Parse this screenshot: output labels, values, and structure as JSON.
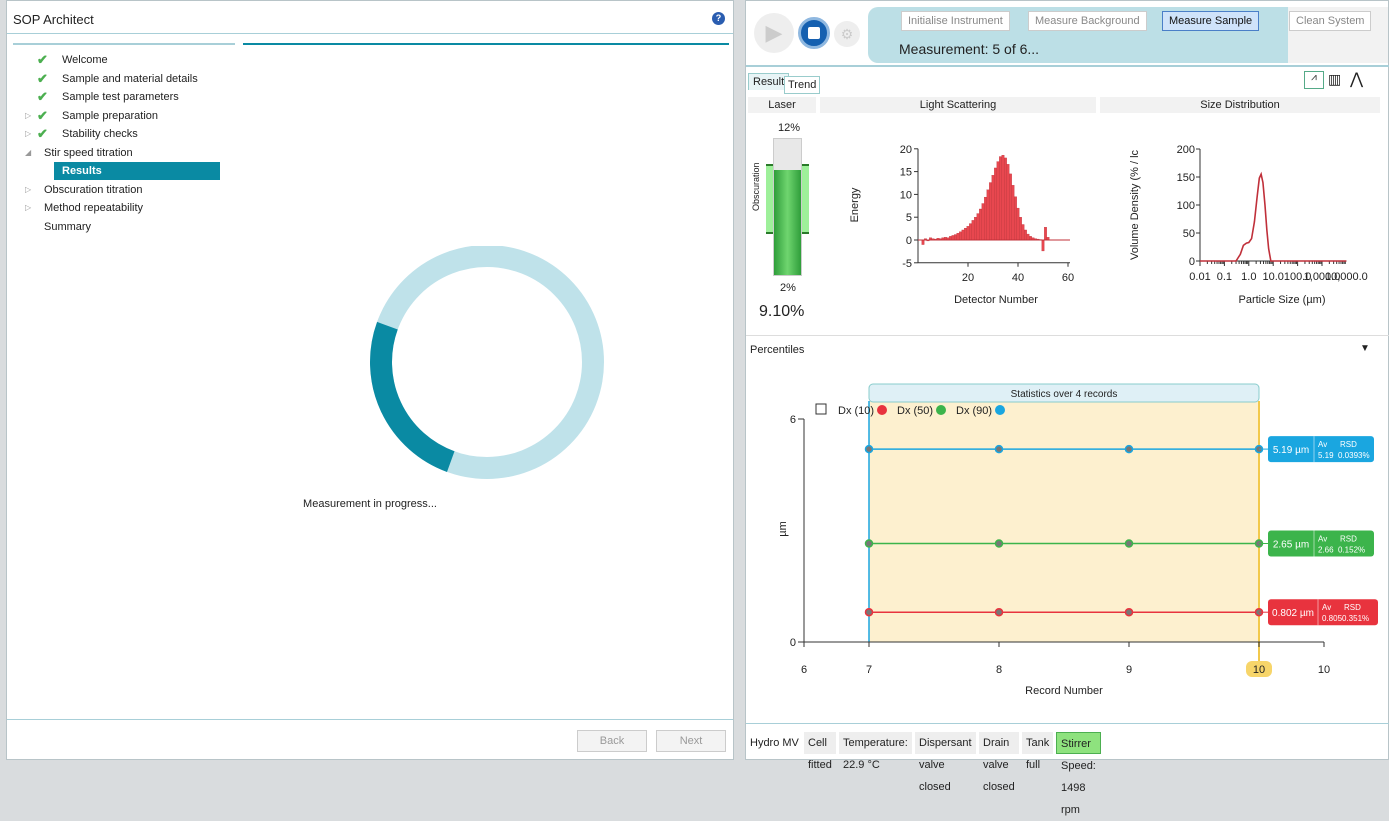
{
  "left": {
    "title": "SOP Architect",
    "help_icon": "help-icon",
    "tree": [
      {
        "label": "Welcome",
        "checked": true,
        "expandable": false,
        "indent": 0
      },
      {
        "label": "Sample and material details",
        "checked": true,
        "expandable": false,
        "indent": 0
      },
      {
        "label": "Sample test parameters",
        "checked": true,
        "expandable": false,
        "indent": 0
      },
      {
        "label": "Sample preparation",
        "checked": true,
        "expandable": true,
        "indent": 0
      },
      {
        "label": "Stability checks",
        "checked": true,
        "expandable": true,
        "indent": 0
      },
      {
        "label": "Stir speed titration",
        "checked": false,
        "expanded": true,
        "indent": 0
      },
      {
        "label": "Results",
        "checked": false,
        "selected": true,
        "indent": 1
      },
      {
        "label": "Obscuration titration",
        "checked": false,
        "expandable": true,
        "indent": 0
      },
      {
        "label": "Method repeatability",
        "checked": false,
        "expandable": true,
        "indent": 0
      },
      {
        "label": "Summary",
        "checked": false,
        "expandable": false,
        "indent": 0
      }
    ],
    "progress_text": "Measurement in progress...",
    "progress_fraction": 0.25,
    "back": "Back",
    "next": "Next"
  },
  "right": {
    "workflow": [
      "Initialise Instrument",
      "Measure Background",
      "Measure Sample",
      "Clean System"
    ],
    "active_step": "Measure Sample",
    "measurement": "Measurement: 5 of 6...",
    "tabs": [
      "Result",
      "Trend"
    ],
    "panels": {
      "laser": "Laser",
      "scatter": "Light Scattering",
      "size": "Size Distribution"
    },
    "laser": {
      "top_label": "12%",
      "bottom_label": "2%",
      "axis": "Obscuration",
      "value": "9.10%",
      "obscuration_pct": 9.1
    },
    "percentiles": "Percentiles",
    "status": {
      "device": "Hydro MV",
      "items": [
        "Cell fitted",
        "Temperature: 22.9 °C",
        "Dispersant valve closed",
        "Drain valve closed",
        "Tank full"
      ],
      "stirrer": "Stirrer Speed: 1498 rpm"
    }
  },
  "colors": {
    "accent": "#0a8aa3",
    "red": "#e8333e",
    "green": "#3cb44b",
    "blue": "#1aa6e0",
    "stats_fill": "#fdf0cf"
  },
  "chart_data": [
    {
      "type": "bar",
      "title": "Light Scattering",
      "xlabel": "Detector Number",
      "ylabel": "Energy",
      "xlim": [
        0,
        62
      ],
      "ylim": [
        -5,
        20
      ],
      "xticks": [
        20,
        40,
        60
      ],
      "yticks": [
        -5,
        0,
        5,
        10,
        15,
        20
      ],
      "x": [
        2,
        3,
        4,
        5,
        6,
        7,
        8,
        9,
        10,
        11,
        12,
        13,
        14,
        15,
        16,
        17,
        18,
        19,
        20,
        21,
        22,
        23,
        24,
        25,
        26,
        27,
        28,
        29,
        30,
        31,
        32,
        33,
        34,
        35,
        36,
        37,
        38,
        39,
        40,
        41,
        42,
        43,
        44,
        45,
        46,
        47,
        48,
        49,
        50,
        51,
        52
      ],
      "values": [
        -1,
        0.3,
        -0.2,
        0.5,
        0.3,
        0.2,
        0.4,
        0.3,
        0.5,
        0.6,
        0.5,
        0.8,
        1,
        1.2,
        1.5,
        1.8,
        2.2,
        2.6,
        3,
        3.6,
        4.3,
        5,
        5.8,
        6.8,
        8,
        9.4,
        11,
        12.6,
        14.2,
        15.8,
        17.2,
        18.3,
        18.6,
        18,
        16.6,
        14.5,
        12,
        9.5,
        7,
        5,
        3.4,
        2.2,
        1.3,
        0.8,
        0.5,
        0.3,
        0.2,
        0.1,
        -2.4,
        2.8,
        0.6
      ]
    },
    {
      "type": "line",
      "title": "Size Distribution",
      "xlabel": "Particle Size (µm)",
      "ylabel": "Volume Density (% / lc",
      "xscale": "log",
      "xlim": [
        0.01,
        10000
      ],
      "ylim": [
        0,
        200
      ],
      "xticks": [
        "0.01",
        "0.1",
        "1.0",
        "10.0",
        "100.0",
        "1,000.0",
        "10,000.0"
      ],
      "yticks": [
        0,
        50,
        100,
        150,
        200
      ],
      "x": [
        0.01,
        0.3,
        0.45,
        0.6,
        0.8,
        1.0,
        1.3,
        1.7,
        2.2,
        2.7,
        3.2,
        3.8,
        4.6,
        5.5,
        6.5,
        8,
        10000
      ],
      "values": [
        0,
        0,
        12,
        28,
        32,
        33,
        40,
        70,
        115,
        148,
        155,
        140,
        100,
        55,
        22,
        0,
        0
      ]
    },
    {
      "type": "line",
      "title": "Statistics over 4 records",
      "xlabel": "Record Number",
      "ylabel": "µm",
      "ylim": [
        0,
        6
      ],
      "xticks": [
        "6",
        "7",
        "8",
        "9",
        "10",
        "10"
      ],
      "yticks": [
        0,
        6
      ],
      "highlight_x": "10",
      "x": [
        7,
        8,
        9,
        10
      ],
      "series": [
        {
          "name": "Dx (10)",
          "color": "#e8333e",
          "values": [
            0.802,
            0.802,
            0.802,
            0.802
          ],
          "current": "0.802 µm",
          "av": "0.805",
          "rsd": "0.351%"
        },
        {
          "name": "Dx (50)",
          "color": "#3cb44b",
          "values": [
            2.65,
            2.65,
            2.65,
            2.65
          ],
          "current": "2.65 µm",
          "av": "2.66",
          "rsd": "0.152%"
        },
        {
          "name": "Dx (90)",
          "color": "#1aa6e0",
          "values": [
            5.19,
            5.19,
            5.19,
            5.19
          ],
          "current": "5.19 µm",
          "av": "5.19",
          "rsd": "0.0393%"
        }
      ],
      "av_label": "Av",
      "rsd_label": "RSD"
    }
  ]
}
